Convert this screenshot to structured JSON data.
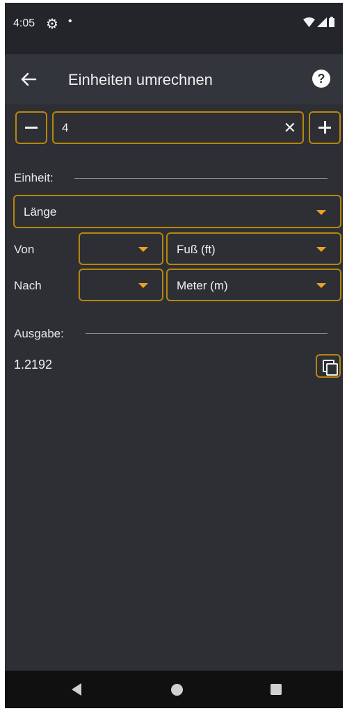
{
  "status_bar": {
    "time": "4:05"
  },
  "app_bar": {
    "title": "Einheiten umrechnen"
  },
  "input": {
    "value": "4"
  },
  "unit_section": {
    "label": "Einheit:",
    "category_selected": "Länge"
  },
  "conversion": {
    "from_label": "Von",
    "from_unit": "Fuß (ft)",
    "to_label": "Nach",
    "to_unit": "Meter (m)"
  },
  "output_section": {
    "label": "Ausgabe:",
    "value": "1.2192"
  },
  "colors": {
    "accent": "#b8860b",
    "arrow": "#f0a020",
    "background": "#2d2f35",
    "app_bar": "#33353c",
    "status_bar": "#23252a"
  }
}
